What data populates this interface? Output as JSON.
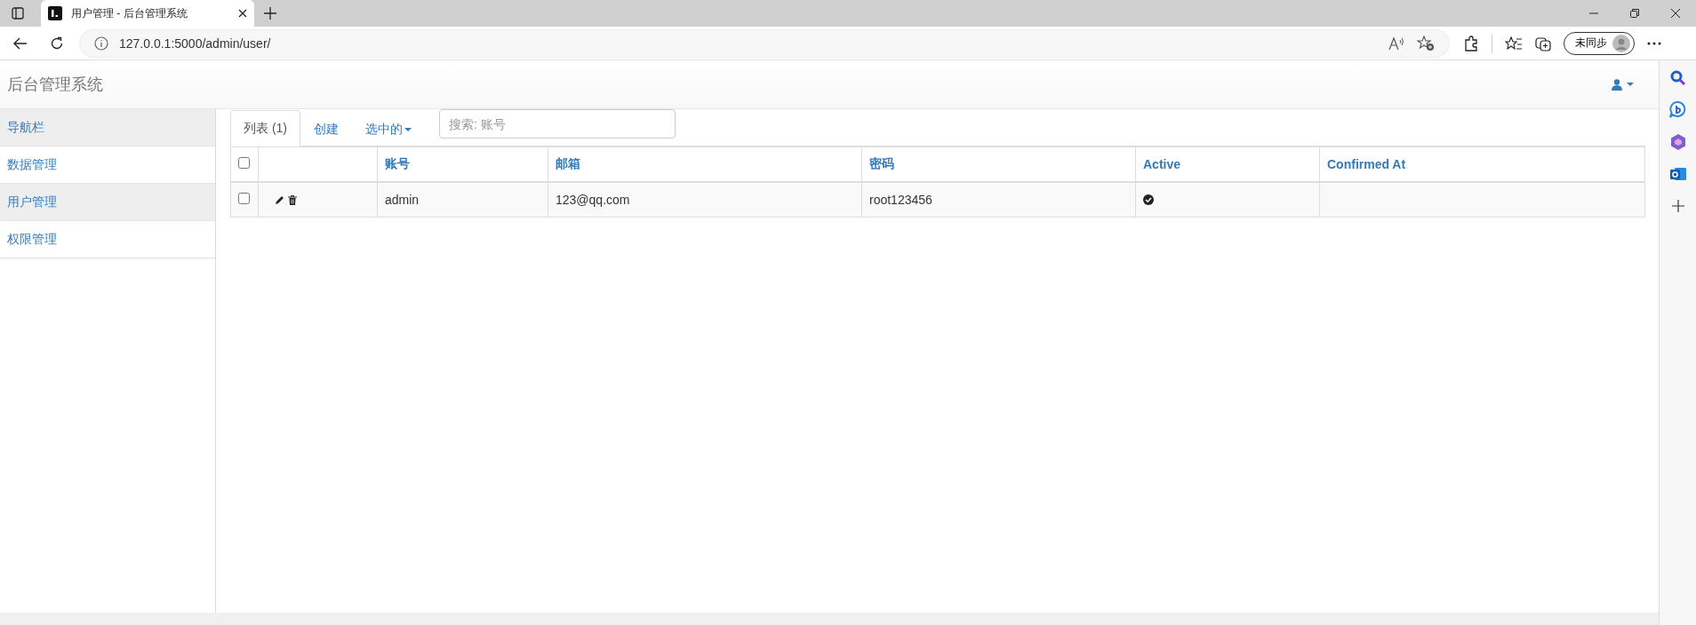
{
  "browser": {
    "tab_title": "用户管理 - 后台管理系统",
    "url": "127.0.0.1:5000/admin/user/",
    "profile_label": "未同步"
  },
  "navbar": {
    "brand": "后台管理系统"
  },
  "sidebar": {
    "items": [
      {
        "label": "导航栏",
        "kind": "header"
      },
      {
        "label": "数据管理",
        "kind": "link",
        "selected": false
      },
      {
        "label": "用户管理",
        "kind": "link",
        "selected": true
      },
      {
        "label": "权限管理",
        "kind": "link",
        "selected": false
      }
    ]
  },
  "tabs": [
    {
      "label": "列表 (1)",
      "kind": "tab",
      "selected": true
    },
    {
      "label": "创建",
      "kind": "tab",
      "selected": false
    },
    {
      "label": "选中的",
      "kind": "dropdown",
      "selected": false
    }
  ],
  "search": {
    "placeholder": "搜索: 账号"
  },
  "table": {
    "select_all": {
      "checked": false
    },
    "columns": [
      "账号",
      "邮箱",
      "密码",
      "Active",
      "Confirmed At"
    ],
    "rows": [
      {
        "checked": false,
        "cells": [
          "admin",
          "123@qq.com",
          "root123456"
        ],
        "active": true,
        "confirmed_at": ""
      }
    ]
  }
}
